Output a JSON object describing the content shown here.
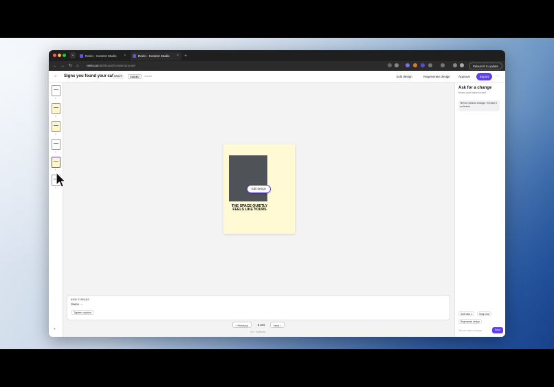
{
  "browser": {
    "tabs": [
      {
        "label": "Reelo · Content Studio",
        "close": "×"
      },
      {
        "label": "Reelo · Content Studio",
        "close": "×"
      }
    ],
    "new_tab": "+",
    "tab_menu": "⌄",
    "nav": {
      "back": "←",
      "forward": "→",
      "reload": "↻",
      "home": "⌂"
    },
    "url_host": "reelo.ca",
    "url_path": "/dashboard/create/carousel",
    "relaunch": "Relaunch to update"
  },
  "app": {
    "back": "←",
    "title": "Signs you found your cafe",
    "status_draft": "DRAFT",
    "status_guided": "GUIDED",
    "saved": "Saved",
    "edit_design": "Edit design",
    "regenerate_design": "Regenerate design",
    "approve": "Approve",
    "export": "Export",
    "more": "···"
  },
  "thumbnails": [
    {
      "number": "1",
      "style": "white"
    },
    {
      "number": "2",
      "style": "yellow"
    },
    {
      "number": "3",
      "style": "yellow"
    },
    {
      "number": "4",
      "style": "white"
    },
    {
      "number": "5",
      "style": "yellow",
      "selected": true
    },
    {
      "number": "6",
      "style": "white"
    }
  ],
  "add_slide": "+",
  "slide": {
    "headline": "THE SPACE QUIETLY FEELS LIKE YOURS",
    "edit_design": "Edit design",
    "background": "#fff9d4"
  },
  "reads": {
    "label": "HOW IT READS",
    "text": "Swipe →",
    "tighten": "Tighten caption"
  },
  "pager": {
    "previous": "‹ Previous",
    "info": "5 of 6",
    "next": "Next ›",
    "note": "4:5 · Eyebrow"
  },
  "panel": {
    "title": "Ask for a change",
    "subtitle": "Keeps your brand locked.",
    "bubble": "Tell me what to change. I'll keep it on-brand.",
    "chips": [
      "Split slide 4",
      "Swap look",
      "Regenerate design"
    ],
    "composer_placeholder": "Tell me what to change",
    "send": "Send"
  },
  "colors": {
    "accent": "#6040e8",
    "slide_bg": "#fff9d4"
  }
}
